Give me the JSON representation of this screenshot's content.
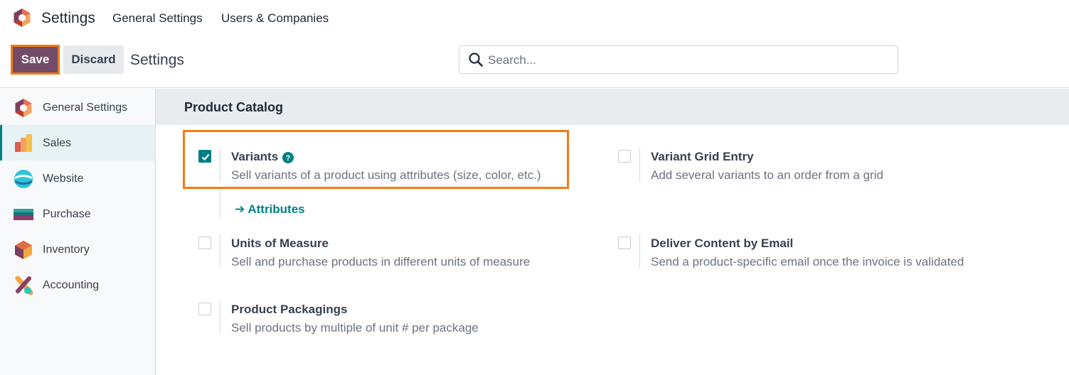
{
  "topbar": {
    "app_title": "Settings",
    "nav": [
      "General Settings",
      "Users & Companies"
    ]
  },
  "control": {
    "save_label": "Save",
    "discard_label": "Discard",
    "breadcrumb": "Settings",
    "search_placeholder": "Search..."
  },
  "sidebar": {
    "items": [
      {
        "label": "General Settings",
        "icon": "odoo-logo-icon",
        "active": false
      },
      {
        "label": "Sales",
        "icon": "sales-icon",
        "active": true
      },
      {
        "label": "Website",
        "icon": "website-icon",
        "active": false
      },
      {
        "label": "Purchase",
        "icon": "purchase-icon",
        "active": false
      },
      {
        "label": "Inventory",
        "icon": "inventory-icon",
        "active": false
      },
      {
        "label": "Accounting",
        "icon": "accounting-icon",
        "active": false
      }
    ]
  },
  "section": {
    "title": "Product Catalog",
    "settings": [
      {
        "title": "Variants",
        "desc": "Sell variants of a product using attributes (size, color, etc.)",
        "checked": true
      },
      {
        "title": "Variant Grid Entry",
        "desc": "Add several variants to an order from a grid",
        "checked": false
      },
      {
        "title": "Units of Measure",
        "desc": "Sell and purchase products in different units of measure",
        "checked": false
      },
      {
        "title": "Deliver Content by Email",
        "desc": "Send a product-specific email once the invoice is validated",
        "checked": false
      },
      {
        "title": "Product Packagings",
        "desc": "Sell products by multiple of unit # per package",
        "checked": false
      }
    ],
    "attributes_link": "Attributes"
  },
  "colors": {
    "brand": "#714b67",
    "accent": "#017e84",
    "highlight": "#f27a16"
  }
}
